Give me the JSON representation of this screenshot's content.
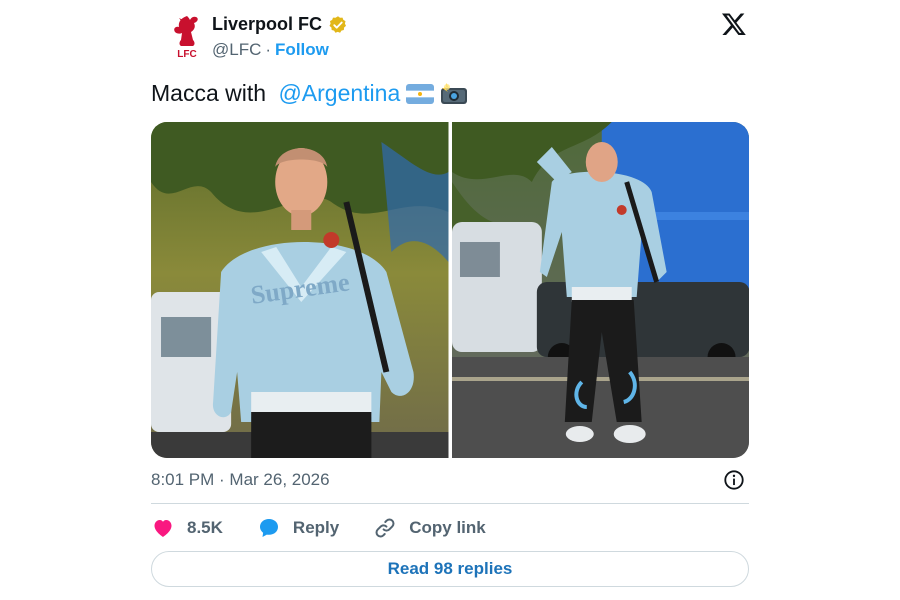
{
  "account": {
    "display_name": "Liverpool FC",
    "handle": "@LFC",
    "separator": "·",
    "follow_label": "Follow",
    "avatar_text": "LFC"
  },
  "tweet": {
    "text_prefix": "Macca with ",
    "mention": "@Argentina",
    "emojis": [
      "argentina-flag",
      "camera-with-flash"
    ]
  },
  "media": {
    "photos": [
      {
        "name": "photo-player-smiling"
      },
      {
        "name": "photo-player-walking"
      }
    ],
    "jacket_text": "Supreme"
  },
  "meta": {
    "timestamp": "8:01 PM · Mar 26, 2026"
  },
  "actions": {
    "like_count": "8.5K",
    "reply_label": "Reply",
    "copy_link_label": "Copy link"
  },
  "footer": {
    "read_replies_label": "Read 98 replies"
  },
  "colors": {
    "accent": "#1d9bf0",
    "link_dark": "#1d73b9",
    "like": "#f91880",
    "muted": "#536471",
    "verified": "#e2b719",
    "lfc_red": "#c8102e"
  },
  "icons": {
    "verified": "verified-badge-icon",
    "x_logo": "x-logo-icon",
    "info": "info-icon",
    "like": "heart-icon",
    "reply": "speech-bubble-icon",
    "copy_link": "link-icon"
  }
}
